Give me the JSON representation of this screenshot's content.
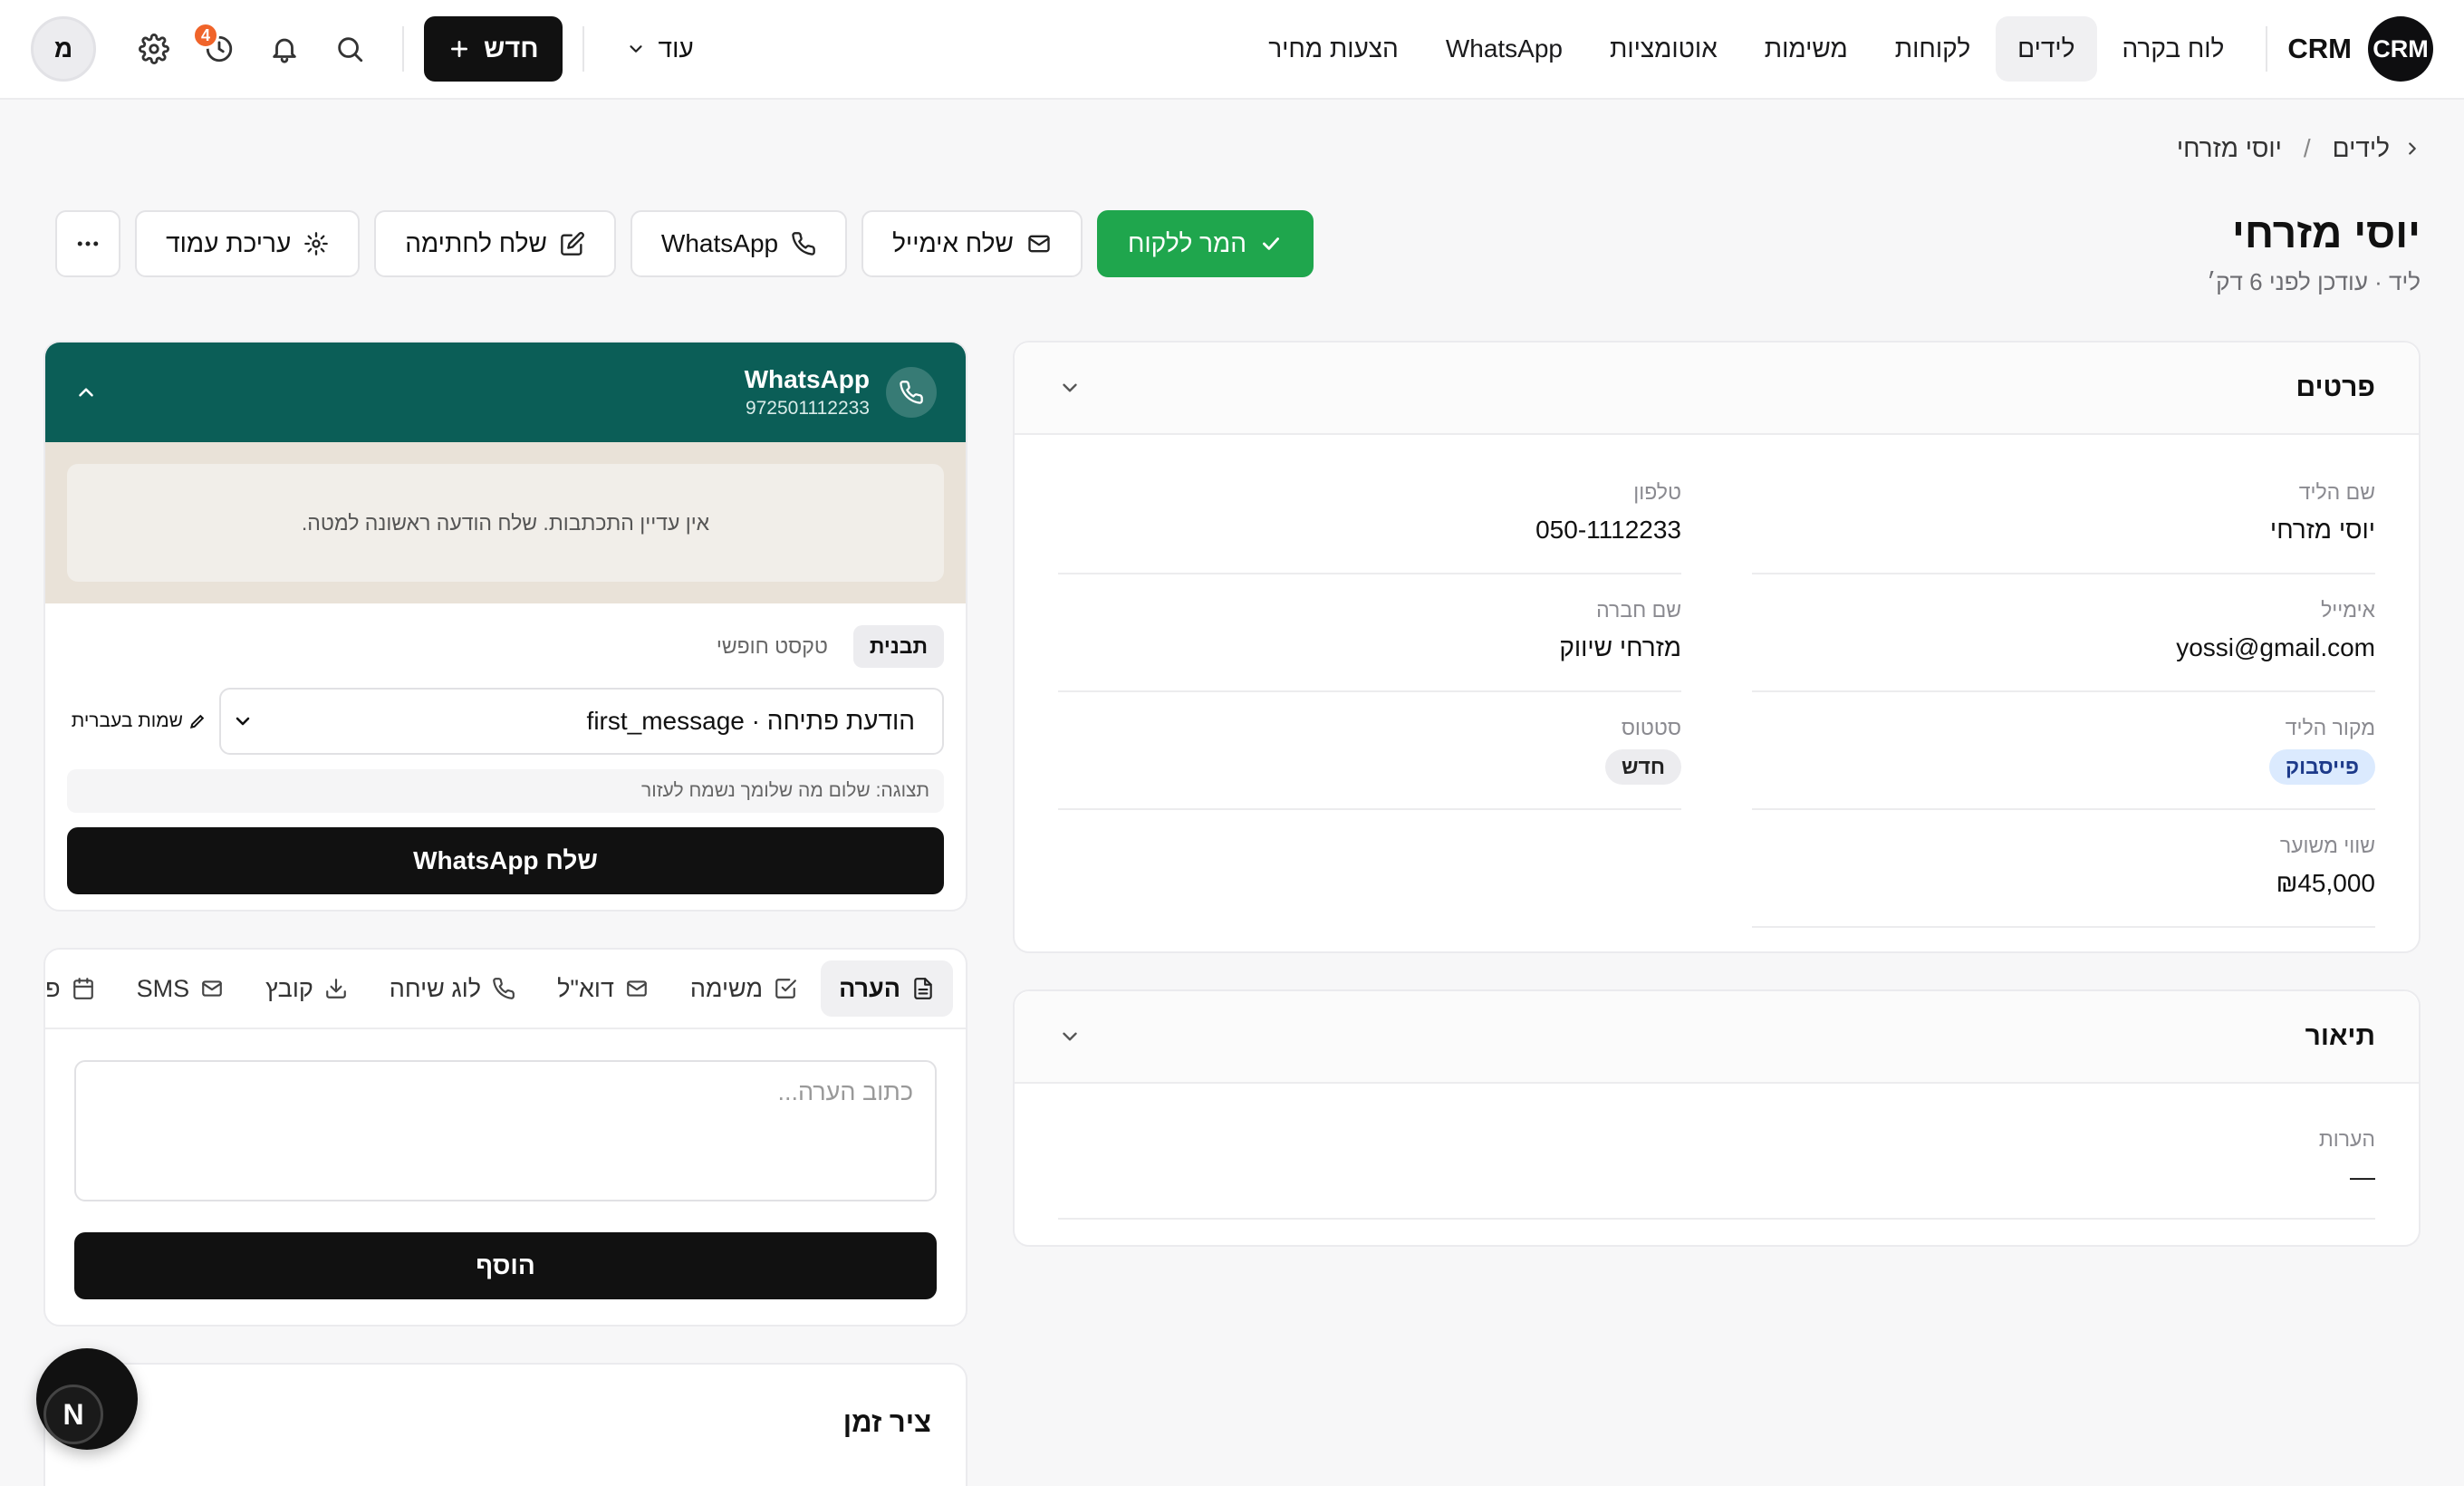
{
  "topbar": {
    "brand_logo": "CRM",
    "brand_name": "CRM",
    "nav": [
      "לוח בקרה",
      "לידים",
      "לקוחות",
      "משימות",
      "אוטומציות",
      "WhatsApp",
      "הצעות מחיר"
    ],
    "active_nav": "לידים",
    "more_label": "עוד",
    "new_label": "חדש",
    "notification_count": "4",
    "user_initial": "מ"
  },
  "breadcrumb": {
    "parent": "לידים",
    "current": "יוסי מזרחי"
  },
  "header": {
    "title": "יוסי מזרחי",
    "subtitle": "ליד · עודכן לפני 6 דק׳"
  },
  "actions": {
    "convert": "המר ללקוח",
    "email": "שלח אימייל",
    "whatsapp": "WhatsApp",
    "sign": "שלח לחתימה",
    "edit_page": "עריכת עמוד"
  },
  "details": {
    "title": "פרטים",
    "fields": {
      "lead_name_label": "שם הליד",
      "lead_name": "יוסי מזרחי",
      "phone_label": "טלפון",
      "phone": "050-1112233",
      "email_label": "אימייל",
      "email": "yossi@gmail.com",
      "company_label": "שם חברה",
      "company": "מזרחי שיווק",
      "source_label": "מקור הליד",
      "source": "פייסבוק",
      "status_label": "סטטוס",
      "status": "חדש",
      "value_label": "שווי משוער",
      "value": "₪45,000"
    }
  },
  "description": {
    "title": "תיאור",
    "notes_label": "הערות",
    "notes_value": "—"
  },
  "whatsapp": {
    "name": "WhatsApp",
    "number": "972501112233",
    "empty_text": "אין עדיין התכתבות. שלח הודעה ראשונה למטה.",
    "mode_template": "תבנית",
    "mode_free": "טקסט חופשי",
    "template_value": "הודעת פתיחה · first_message",
    "hebrew_names": "שמות בעברית",
    "preview": "תצוגה: שלום מה שלומך נשמח לעזור",
    "send_label": "שלח WhatsApp"
  },
  "composer": {
    "tabs": [
      "הערה",
      "משימה",
      "דוא\"ל",
      "לוג שיחה",
      "קובץ",
      "SMS",
      "פגישה"
    ],
    "placeholder": "כתוב הערה...",
    "add_label": "הוסף"
  },
  "timeline": {
    "title": "ציר זמן"
  },
  "fab": {
    "label": "N"
  }
}
